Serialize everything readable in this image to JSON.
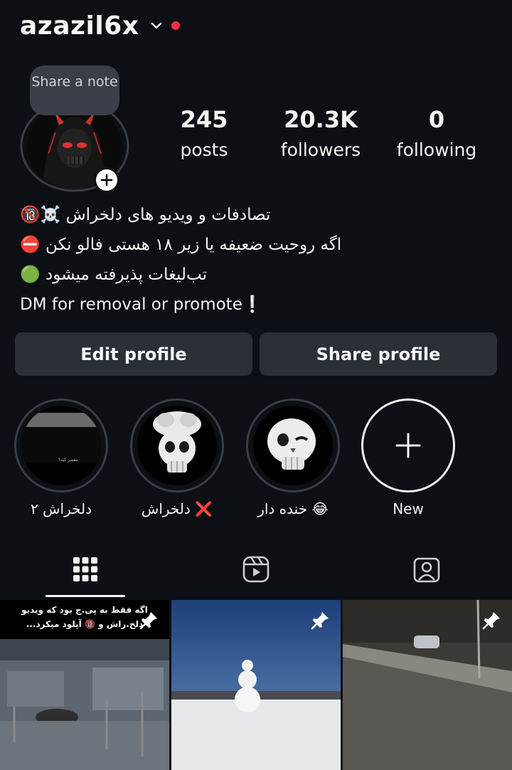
{
  "header": {
    "username": "azazil6x"
  },
  "profile": {
    "note_bubble": "Share a note",
    "stats": [
      {
        "value": "245",
        "label": "posts"
      },
      {
        "value": "20.3K",
        "label": "followers"
      },
      {
        "value": "0",
        "label": "following"
      }
    ],
    "bio": [
      "تصادفات و ویدیو های دلخراش ☠️🔞",
      "اگه روحیت ضعیفه یا زیر ۱۸ هستی فالو نکن ⛔",
      "تب‌لیغات پذیرفته میشود 🟢",
      "DM for removal or promote❕"
    ]
  },
  "buttons": {
    "edit": "Edit profile",
    "share": "Share profile"
  },
  "highlights": [
    {
      "label": "دلخراش ۲",
      "cover_text": "مقصر کیه؟"
    },
    {
      "label": "دلخراش ❌"
    },
    {
      "label": "خنده دار 😂"
    },
    {
      "label": "New"
    }
  ],
  "posts": [
    {
      "caption": "اگه فقط به پی.ج بود که ویدیو دلخ.راش و 🔞 آپلود میکرد..."
    },
    {
      "caption": ""
    },
    {
      "caption": ""
    }
  ],
  "colors": {
    "background": "#0c0f14",
    "button": "#2b2f36",
    "accent_dot": "#ff3040"
  }
}
